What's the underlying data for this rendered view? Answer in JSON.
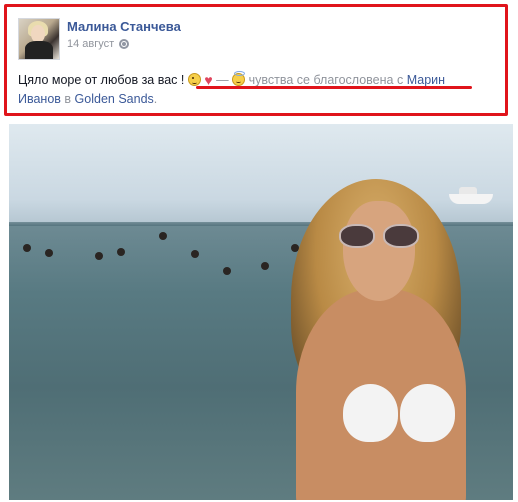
{
  "post": {
    "author": "Малина Станчева",
    "date": "14 август",
    "privacy_icon": "globe-icon",
    "status_text": "Цяло море от любов за вас !",
    "dash": "—",
    "feeling_text": "чувства се благословена с",
    "tagged_person_line1": "Марин",
    "tagged_person_line2": "Иванов",
    "in_word": "в",
    "location": "Golden Sands",
    "period": "."
  },
  "emojis": {
    "first": "wink-emoji-icon",
    "heart": "♥",
    "feeling": "angel-emoji-icon"
  },
  "colors": {
    "highlight_border": "#e0141b",
    "link": "#3b5998",
    "muted": "#90949c"
  }
}
